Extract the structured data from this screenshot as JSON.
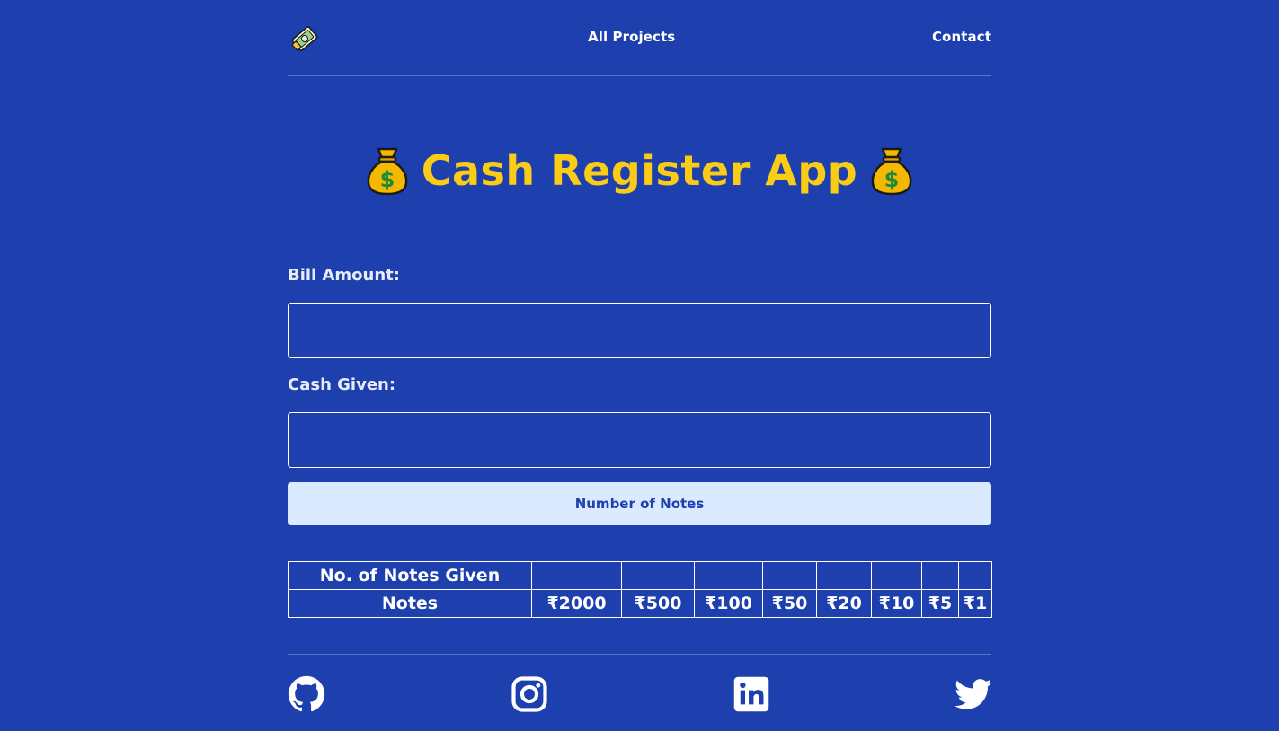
{
  "nav": {
    "all_projects": "All Projects",
    "contact": "Contact"
  },
  "title": "Cash Register App",
  "form": {
    "bill_label": "Bill Amount:",
    "bill_value": "",
    "cash_label": "Cash Given:",
    "cash_value": "",
    "button_label": "Number of Notes"
  },
  "table": {
    "row1_header": "No. of Notes Given",
    "row1_values": [
      "",
      "",
      "",
      "",
      "",
      "",
      "",
      ""
    ],
    "row2_header": "Notes",
    "notes": [
      "₹2000",
      "₹500",
      "₹100",
      "₹50",
      "₹20",
      "₹10",
      "₹5",
      "₹1"
    ]
  },
  "colors": {
    "background": "#1e40af",
    "title": "#facc15",
    "button_bg": "#dbeafe",
    "button_text": "#1e40af"
  },
  "icons": {
    "logo": "money-logo-icon",
    "title_left": "money-bag-icon",
    "title_right": "money-bag-icon",
    "footer": [
      "github-icon",
      "instagram-icon",
      "linkedin-icon",
      "twitter-icon"
    ]
  }
}
